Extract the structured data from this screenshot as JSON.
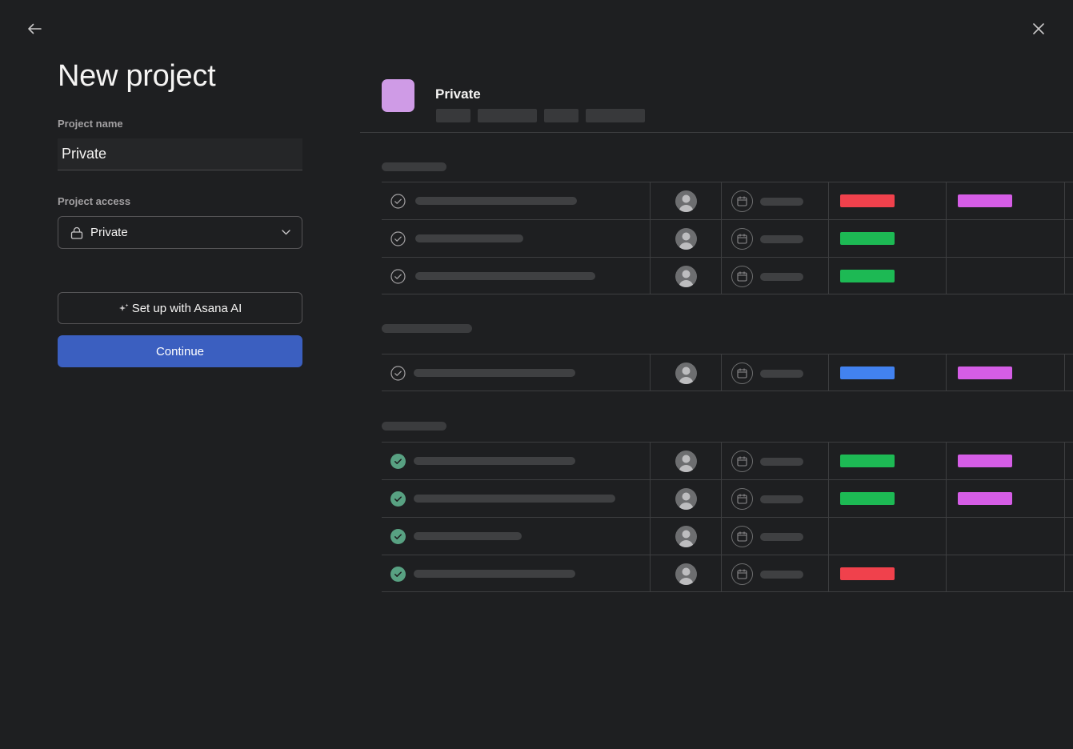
{
  "dialog": {
    "title": "New project",
    "project_name_label": "Project name",
    "project_name_value": "Private",
    "project_access_label": "Project access",
    "project_access_value": "Private",
    "ai_button_label": "Set up with Asana AI",
    "continue_label": "Continue"
  },
  "preview": {
    "project_title": "Private",
    "project_color": "#cf9be6"
  },
  "colors": {
    "background": "#1e1f21",
    "primary_button": "#3b5fc0",
    "tag_red": "#f0414c",
    "tag_green": "#1db954",
    "tag_blue": "#4282f0",
    "tag_magenta": "#d55de6",
    "check_complete": "#58a182"
  }
}
